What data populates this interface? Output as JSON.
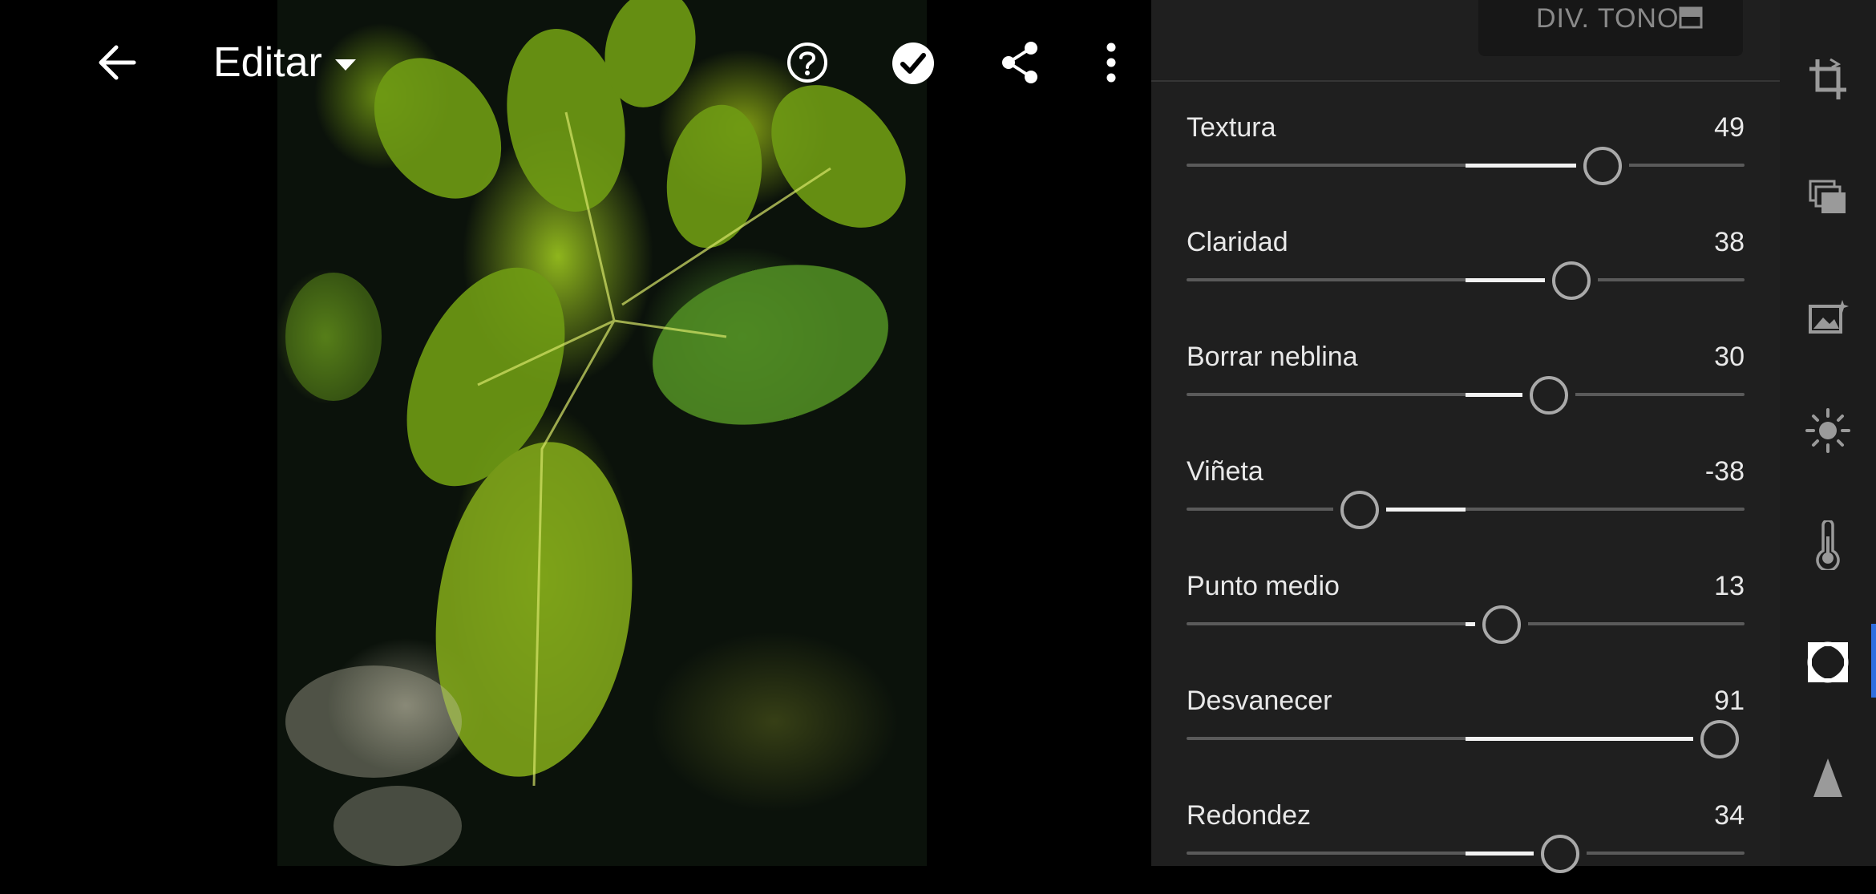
{
  "header": {
    "back_icon": "arrow-left-icon",
    "title": "Editar",
    "dropdown_icon": "caret-down-icon",
    "help_icon": "help-circle-icon",
    "done_icon": "check-circle-icon",
    "share_icon": "share-icon",
    "more_icon": "more-vertical-icon"
  },
  "panel": {
    "split_tone_label": "DIV. TONO",
    "split_tone_icon": "split-view-icon",
    "sliders": [
      {
        "label": "Textura",
        "value": "49",
        "level": 49
      },
      {
        "label": "Claridad",
        "value": "38",
        "level": 38
      },
      {
        "label": "Borrar neblina",
        "value": "30",
        "level": 30
      },
      {
        "label": "Viñeta",
        "value": "-38",
        "level": -38
      },
      {
        "label": "Punto medio",
        "value": "13",
        "level": 13
      },
      {
        "label": "Desvanecer",
        "value": "91",
        "level": 91
      },
      {
        "label": "Redondez",
        "value": "34",
        "level": 34
      }
    ]
  },
  "rail": {
    "tools": [
      "crop-icon",
      "presets-icon",
      "auto-enhance-icon",
      "light-icon",
      "color-temperature-icon",
      "effects-icon",
      "detail-icon"
    ],
    "active_tool": "effects-icon"
  },
  "colors": {
    "panel_bg": "#1f1f1f",
    "rail_bg": "#1c1c1c",
    "accent": "#2f6fe0",
    "track": "#5a5a5a",
    "fill": "#f2f2f2"
  }
}
